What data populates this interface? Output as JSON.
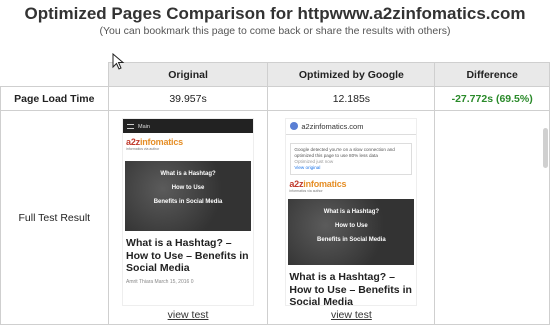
{
  "header": {
    "title": "Optimized Pages Comparison for httpwww.a2zinfomatics.com",
    "subtitle": "(You can bookmark this page to come back or share the results with others)"
  },
  "table": {
    "columns": [
      "Original",
      "Optimized by Google",
      "Difference"
    ],
    "rows": {
      "load_time": {
        "label": "Page Load Time",
        "original": "39.957s",
        "optimized": "12.185s",
        "difference": "-27.772s (69.5%)"
      },
      "full_test": {
        "label": "Full Test Result",
        "view_test": "view test"
      }
    }
  },
  "thumb_original": {
    "bar_label": "Main",
    "logo_a": "a2z",
    "logo_b": "infomatics",
    "logo_sub": "informatics via author",
    "hero_lines": [
      "What is a Hashtag?",
      "How to Use",
      "Benefits in Social Media"
    ],
    "post_title": "What is a Hashtag? – How to Use – Benefits in Social Media",
    "meta": "Amrit Thiara  March 15, 2016  0"
  },
  "thumb_optimized": {
    "header": "a2zinfomatics.com",
    "notice": "Google detected you're on a slow connection and optimized this page to use 80% less data",
    "notice_sub": "Optimized just now",
    "notice_link": "View original",
    "logo_a": "a2z",
    "logo_b": "infomatics",
    "logo_sub": "informatics via author",
    "hero_lines": [
      "What is a Hashtag?",
      "How to Use",
      "Benefits in Social Media"
    ],
    "post_title": "What is a Hashtag? – How to Use – Benefits in Social Media"
  },
  "colors": {
    "difference": "#2a8a2a",
    "header_bg": "#e9e9e9"
  }
}
